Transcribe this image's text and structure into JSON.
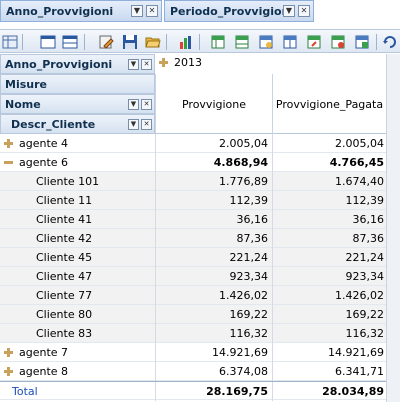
{
  "filters": [
    {
      "label": "Anno_Provvigioni"
    },
    {
      "label": "Periodo_Provvigioni"
    }
  ],
  "toolbar": {
    "icons": [
      "grid-icon",
      "layout-icon",
      "table-icon",
      "edit-icon",
      "save-icon",
      "open-folder-icon",
      "bar-chart-icon",
      "export-excel-icon",
      "export-icon",
      "export-icon",
      "export-icon",
      "export-icon",
      "export-icon",
      "export-icon",
      "refresh-icon"
    ]
  },
  "headers": {
    "row_field": "Anno_Provvigioni",
    "measures": "Misure",
    "name": "Nome",
    "descr": "Descr_Cliente",
    "year": "2013",
    "col1": "Provvigione",
    "col2": "Provvigione_Pagata"
  },
  "rows": [
    {
      "label": "agente 4",
      "v1": "2.005,04",
      "v2": "2.005,04",
      "type": "collapsed"
    },
    {
      "label": "agente 6",
      "v1": "4.868,94",
      "v2": "4.766,45",
      "type": "expanded"
    },
    {
      "label": "Cliente 101",
      "v1": "1.776,89",
      "v2": "1.674,40",
      "type": "child"
    },
    {
      "label": "Cliente 11",
      "v1": "112,39",
      "v2": "112,39",
      "type": "child"
    },
    {
      "label": "Cliente 41",
      "v1": "36,16",
      "v2": "36,16",
      "type": "child"
    },
    {
      "label": "Cliente 42",
      "v1": "87,36",
      "v2": "87,36",
      "type": "child"
    },
    {
      "label": "Cliente 45",
      "v1": "221,24",
      "v2": "221,24",
      "type": "child"
    },
    {
      "label": "Cliente 47",
      "v1": "923,34",
      "v2": "923,34",
      "type": "child"
    },
    {
      "label": "Cliente 77",
      "v1": "1.426,02",
      "v2": "1.426,02",
      "type": "child"
    },
    {
      "label": "Cliente 80",
      "v1": "169,22",
      "v2": "169,22",
      "type": "child"
    },
    {
      "label": "Cliente 83",
      "v1": "116,32",
      "v2": "116,32",
      "type": "child"
    },
    {
      "label": "agente 7",
      "v1": "14.921,69",
      "v2": "14.921,69",
      "type": "collapsed"
    },
    {
      "label": "agente 8",
      "v1": "6.374,08",
      "v2": "6.341,71",
      "type": "collapsed"
    },
    {
      "label": "Total",
      "v1": "28.169,75",
      "v2": "28.034,89",
      "type": "total"
    }
  ],
  "colors": {
    "accent": "#10304f",
    "border": "#b8c8dd",
    "total": "#1a4fb4"
  }
}
